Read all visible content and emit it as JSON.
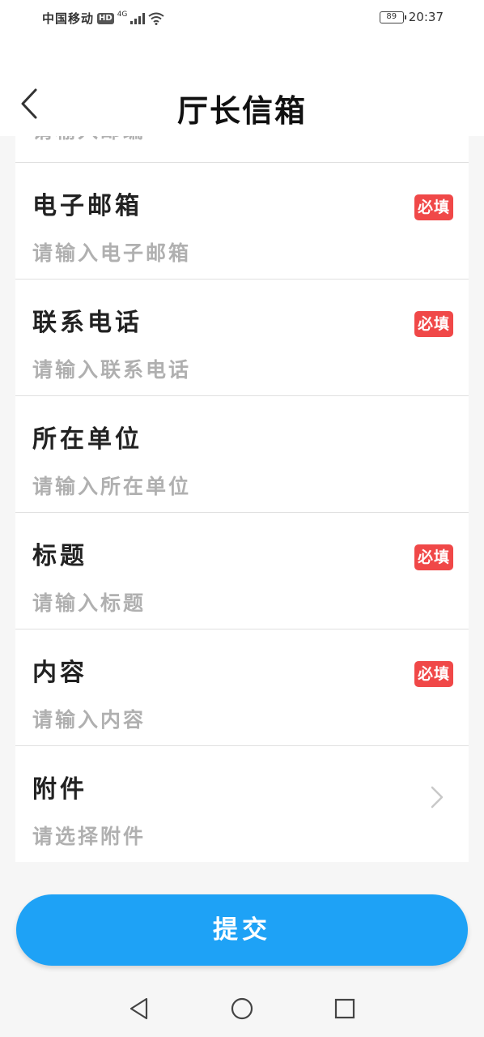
{
  "status_bar": {
    "carrier": "中国移动",
    "hd": "HD",
    "network": "4G",
    "battery": "89",
    "time": "20:37"
  },
  "header": {
    "title": "厅长信箱",
    "back_icon": "chevron-left-icon"
  },
  "form": {
    "partial_placeholder": "请输入邮编",
    "required_label": "必填",
    "fields": [
      {
        "label": "电子邮箱",
        "placeholder": "请输入电子邮箱",
        "required": true
      },
      {
        "label": "联系电话",
        "placeholder": "请输入联系电话",
        "required": true
      },
      {
        "label": "所在单位",
        "placeholder": "请输入所在单位",
        "required": false
      },
      {
        "label": "标题",
        "placeholder": "请输入标题",
        "required": true
      },
      {
        "label": "内容",
        "placeholder": "请输入内容",
        "required": true
      },
      {
        "label": "附件",
        "placeholder": "请选择附件",
        "required": false,
        "chevron_icon": "chevron-right-icon"
      }
    ]
  },
  "submit_label": "提交",
  "system_nav": {
    "back_icon": "triangle-back-icon",
    "home_icon": "circle-home-icon",
    "recents_icon": "square-recents-icon"
  },
  "colors": {
    "accent": "#1ea2f6",
    "required_badge": "#f04848",
    "placeholder": "#b0b0b0"
  }
}
